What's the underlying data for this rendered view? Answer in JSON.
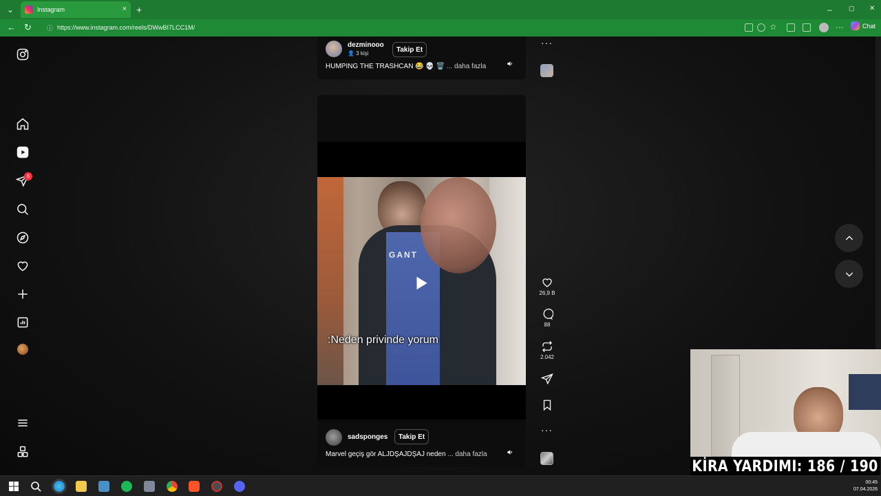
{
  "browser": {
    "tab_title": "Instagram",
    "tab_close": "×",
    "new_tab": "+",
    "url": "https://www.instagram.com/reels/DWwBI7LCC1M/",
    "chat_label": "Chat",
    "window_min": "–",
    "window_max": "▢",
    "window_close": "✕"
  },
  "sidebar": {
    "notifications_badge": "6",
    "items": [
      "instagram-logo",
      "home",
      "reels",
      "messages",
      "search",
      "explore",
      "notifications",
      "create",
      "dashboard",
      "profile",
      "more",
      "also-from-meta"
    ]
  },
  "top_reel": {
    "username": "dezminooo",
    "audience": "3 kişi",
    "follow_label": "Takip Et",
    "caption": "HUMPING THE TRASHCAN 😂 💀 🗑️",
    "more_label": "... daha fazla"
  },
  "main_reel": {
    "subtitle": ":Neden privinde yorum",
    "username": "sadsponges",
    "follow_label": "Takip Et",
    "caption": "Marvel geçiş gör ALJDŞAJDŞAJ neden",
    "more_label": "... daha fazla",
    "likes": "26,9 B",
    "comments": "88",
    "reposts": "2.042",
    "more_dots": "···"
  },
  "top_dots": "···",
  "overlay": {
    "rent_text": "KİRA YARDIMI:  186 / 190"
  },
  "taskbar": {
    "time": "00:45",
    "date": "07.04.2026"
  },
  "colors": {
    "tab_green": "#1e7a31",
    "badge_red": "#ff3040",
    "page_bg": "#121212"
  }
}
